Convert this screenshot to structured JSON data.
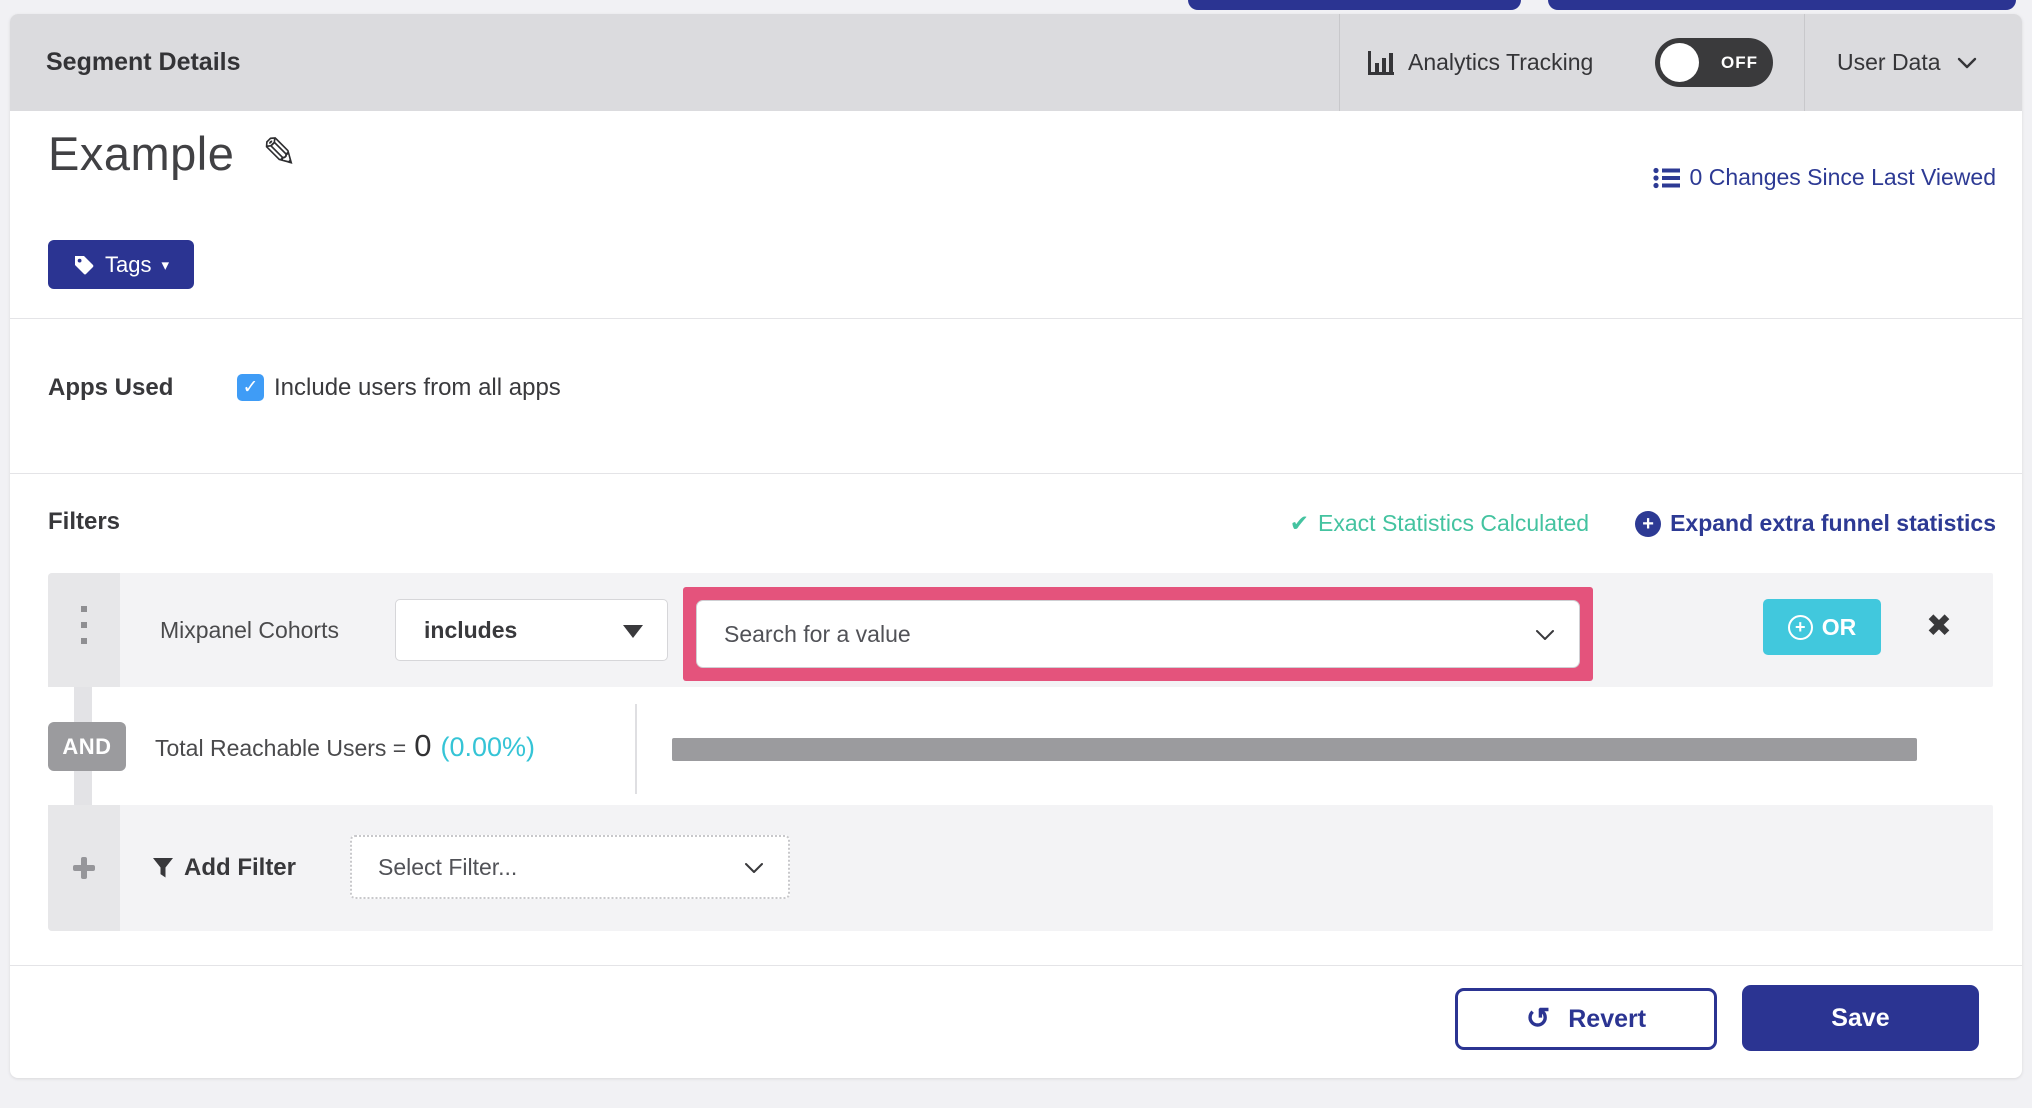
{
  "header": {
    "title": "Segment Details",
    "analytics_tracking_label": "Analytics Tracking",
    "analytics_toggle_state": "OFF",
    "user_data_label": "User Data"
  },
  "segment": {
    "name": "Example",
    "changes_link": "0 Changes Since Last Viewed",
    "tags_label": "Tags"
  },
  "apps_used": {
    "label": "Apps Used",
    "checkbox_label": "Include users from all apps",
    "checked": true
  },
  "filters": {
    "heading": "Filters",
    "exact_statistics_label": "Exact Statistics Calculated",
    "expand_link_label": "Expand extra funnel statistics",
    "row": {
      "field": "Mixpanel Cohorts",
      "operator": "includes",
      "value_placeholder": "Search for a value",
      "or_label": "OR"
    },
    "conjunction": "AND",
    "total_reachable_prefix": "Total Reachable Users = ",
    "total_reachable_count": "0",
    "total_reachable_percent": "(0.00%)",
    "add_filter_label": "Add Filter",
    "select_filter_placeholder": "Select Filter..."
  },
  "footer": {
    "revert_label": "Revert",
    "save_label": "Save"
  },
  "icons": {
    "edit": "✎",
    "close": "✖",
    "checkbox_check": "✓",
    "exact_check": "✔",
    "caret_down": "▾",
    "plus": "+",
    "revert": "↺"
  },
  "colors": {
    "indigo_primary": "#2b3492",
    "indigo_link": "#2d3a94",
    "teal_or_button": "#41c8dd",
    "green_exact_stats": "#44c3a0",
    "cyan_percent": "#35c4d6",
    "pink_highlight": "#e4537c",
    "checkbox_blue": "#3f9cf6",
    "toggle_off_bg": "#3a3a3c",
    "header_bar_bg": "#dbdbde",
    "row_bg": "#f3f3f5",
    "progress_bar": "#9b9b9e"
  }
}
